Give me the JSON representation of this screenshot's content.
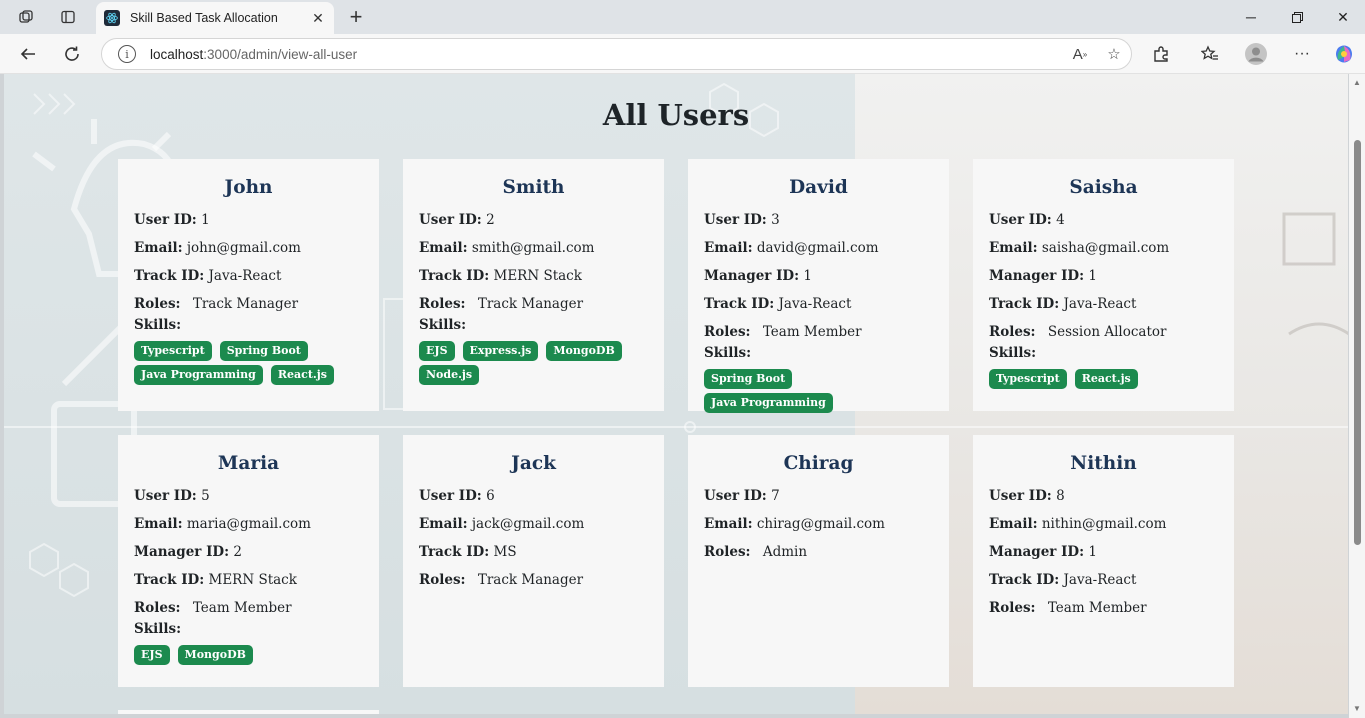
{
  "browser": {
    "tab_title": "Skill Based Task Allocation",
    "url_host": "localhost",
    "url_path": ":3000/admin/view-all-user"
  },
  "page": {
    "title": "All Users",
    "labels": {
      "user_id": "User ID:",
      "email": "Email:",
      "manager_id": "Manager ID:",
      "track_id": "Track ID:",
      "roles": "Roles:",
      "skills": "Skills:"
    }
  },
  "users": [
    {
      "name": "John",
      "user_id": "1",
      "email": "john@gmail.com",
      "track_id": "Java-React",
      "roles": "Track Manager",
      "skills": [
        "Typescript",
        "Spring Boot",
        "Java Programming",
        "React.js"
      ]
    },
    {
      "name": "Smith",
      "user_id": "2",
      "email": "smith@gmail.com",
      "track_id": "MERN Stack",
      "roles": "Track Manager",
      "skills": [
        "EJS",
        "Express.js",
        "MongoDB",
        "Node.js"
      ]
    },
    {
      "name": "David",
      "user_id": "3",
      "email": "david@gmail.com",
      "manager_id": "1",
      "track_id": "Java-React",
      "roles": "Team Member",
      "skills": [
        "Spring Boot",
        "Java Programming"
      ]
    },
    {
      "name": "Saisha",
      "user_id": "4",
      "email": "saisha@gmail.com",
      "manager_id": "1",
      "track_id": "Java-React",
      "roles": "Session Allocator",
      "skills": [
        "Typescript",
        "React.js"
      ]
    },
    {
      "name": "Maria",
      "user_id": "5",
      "email": "maria@gmail.com",
      "manager_id": "2",
      "track_id": "MERN Stack",
      "roles": "Team Member",
      "skills": [
        "EJS",
        "MongoDB"
      ]
    },
    {
      "name": "Jack",
      "user_id": "6",
      "email": "jack@gmail.com",
      "track_id": "MS",
      "roles": "Track Manager"
    },
    {
      "name": "Chirag",
      "user_id": "7",
      "email": "chirag@gmail.com",
      "roles": "Admin"
    },
    {
      "name": "Nithin",
      "user_id": "8",
      "email": "nithin@gmail.com",
      "manager_id": "1",
      "track_id": "Java-React",
      "roles": "Team Member"
    }
  ]
}
